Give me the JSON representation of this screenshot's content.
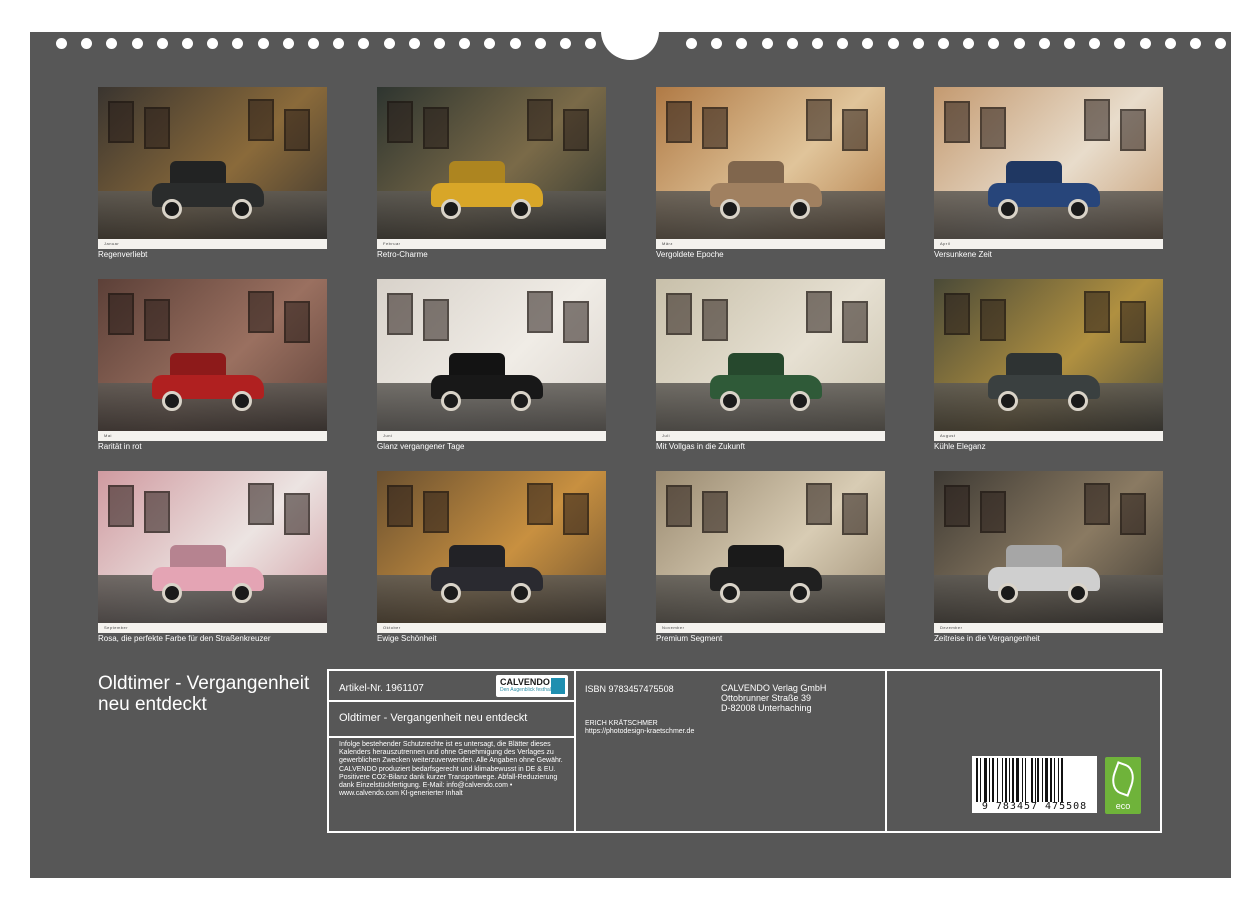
{
  "thumbnails": [
    {
      "caption": "Regenverliebt",
      "month": "Januar",
      "palette": [
        "#3a3530",
        "#8a6a3a"
      ],
      "car": "#2a2c2c"
    },
    {
      "caption": "Retro-Charme",
      "month": "Februar",
      "palette": [
        "#2e3530",
        "#7a6a48"
      ],
      "car": "#d8a628"
    },
    {
      "caption": "Vergoldete Epoche",
      "month": "März",
      "palette": [
        "#b07a45",
        "#e0c49a"
      ],
      "car": "#a08060"
    },
    {
      "caption": "Versunkene Zeit",
      "month": "April",
      "palette": [
        "#c49a70",
        "#e8dccb"
      ],
      "car": "#27457a"
    },
    {
      "caption": "Rarität in rot",
      "month": "Mai",
      "palette": [
        "#5c4038",
        "#9a7060"
      ],
      "car": "#b02020"
    },
    {
      "caption": "Glanz vergangener Tage",
      "month": "Juni",
      "palette": [
        "#d8d2ca",
        "#f0ece6"
      ],
      "car": "#181818"
    },
    {
      "caption": "Mit Vollgas in die Zukunft",
      "month": "Juli",
      "palette": [
        "#c8c0aa",
        "#e6e0d2"
      ],
      "car": "#2f5a38"
    },
    {
      "caption": "Kühle Eleganz",
      "month": "August",
      "palette": [
        "#4a4a38",
        "#b09040"
      ],
      "car": "#3a4040"
    },
    {
      "caption": "Rosa, die perfekte Farbe für den Straßenkreuzer",
      "month": "September",
      "palette": [
        "#d09aa0",
        "#ece4e2"
      ],
      "car": "#e4a4b4"
    },
    {
      "caption": "Ewige Schönheit",
      "month": "Oktober",
      "palette": [
        "#6a5030",
        "#c89040"
      ],
      "car": "#2a2a30"
    },
    {
      "caption": "Premium Segment",
      "month": "November",
      "palette": [
        "#9a8a70",
        "#d8ccb4"
      ],
      "car": "#202020"
    },
    {
      "caption": "Zeitreise in die Vergangenheit",
      "month": "Dezember",
      "palette": [
        "#3e3a34",
        "#8a7a62"
      ],
      "car": "#cfcfcf"
    }
  ],
  "title": "Oldtimer - Vergangenheit neu entdeckt",
  "panel": {
    "article": "Artikel-Nr. 1961107",
    "logo_name": "CALVENDO",
    "logo_sub": "Den Augenblick festhalten",
    "subtitle": "Oldtimer - Vergangenheit neu entdeckt",
    "legal": "Infolge bestehender Schutzrechte ist es untersagt, die Blätter dieses Kalenders herauszutrennen und ohne Genehmigung des Verlages zu gewerblichen Zwecken weiterzuverwenden. Alle Angaben ohne Gewähr. CALVENDO produziert bedarfsgerecht und klimabewusst in DE & EU. Positivere CO2-Bilanz dank kurzer Transportwege. Abfall-Reduzierung dank Einzelstückfertigung. E-Mail: info@calvendo.com • www.calvendo.com KI-generierter Inhalt",
    "isbn": "ISBN 9783457475508",
    "publisher_name": "CALVENDO Verlag GmbH",
    "publisher_street": "Ottobrunner Straße 39",
    "publisher_city": "D-82008 Unterhaching",
    "author": "ERICH KRÄTSCHMER",
    "author_url": "https://photodesign-kraetschmer.de",
    "barcode_digits": "9 783457 475508",
    "eco_label": "eco"
  }
}
